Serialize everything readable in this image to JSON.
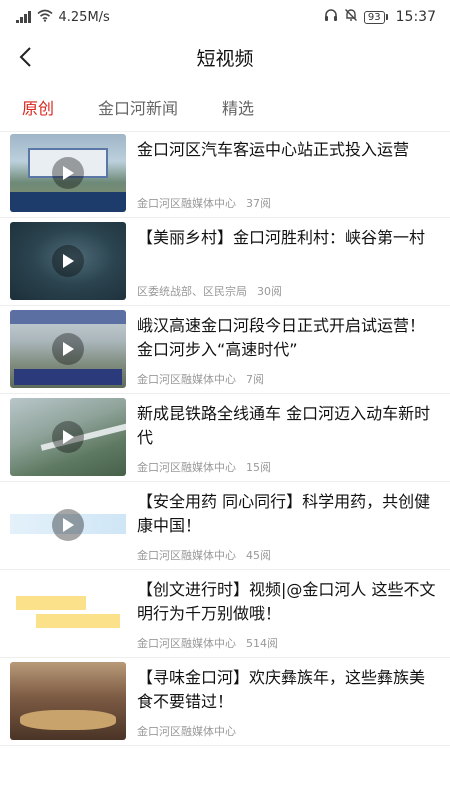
{
  "status_bar": {
    "network_speed": "4.25M/s",
    "battery": "93",
    "time": "15:37",
    "icons": [
      "signal-icon",
      "wifi-icon",
      "headset-icon",
      "mute-icon",
      "battery-icon"
    ]
  },
  "nav": {
    "title": "短视频",
    "back_icon": "chevron-left-icon"
  },
  "tabs": [
    {
      "label": "原创",
      "active": true
    },
    {
      "label": "金口河新闻",
      "active": false
    },
    {
      "label": "精选",
      "active": false
    }
  ],
  "colors": {
    "accent": "#d9261c",
    "text": "#111111",
    "meta": "#999999",
    "divider": "#eeeeee"
  },
  "feed": [
    {
      "title": "金口河区汽车客运中心站正式投入运营",
      "source": "金口河区融媒体中心",
      "views": "37阅"
    },
    {
      "title": "【美丽乡村】金口河胜利村：峡谷第一村",
      "source": "区委统战部、区民宗局",
      "views": "30阅"
    },
    {
      "title": "峨汉高速金口河段今日正式开启试运营！金口河步入“高速时代”",
      "source": "金口河区融媒体中心",
      "views": "7阅"
    },
    {
      "title": "新成昆铁路全线通车 金口河迈入动车新时代",
      "source": "金口河区融媒体中心",
      "views": "15阅"
    },
    {
      "title": "【安全用药 同心同行】科学用药，共创健康中国！",
      "source": "金口河区融媒体中心",
      "views": "45阅"
    },
    {
      "title": "【创文进行时】视频|@金口河人 这些不文明行为千万别做哦！",
      "source": "金口河区融媒体中心",
      "views": "514阅"
    },
    {
      "title": "【寻味金口河】欢庆彝族年，这些彝族美食不要错过！",
      "source": "金口河区融媒体中心",
      "views": ""
    }
  ]
}
